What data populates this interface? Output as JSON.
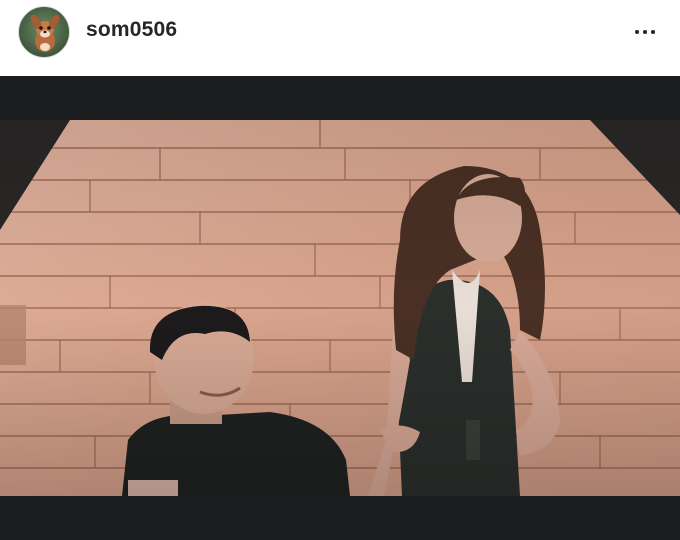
{
  "post": {
    "username": "som0506",
    "avatar_icon": "bambi-avatar-icon",
    "more_icon": "more-options-icon"
  },
  "colors": {
    "header_bg": "#ffffff",
    "letterbox": "#1c1d1f",
    "wall_base": "#d9a58e",
    "username_text": "#262626"
  }
}
